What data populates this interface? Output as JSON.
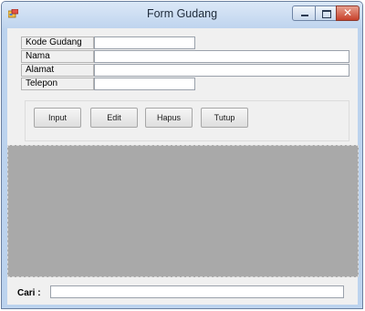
{
  "window": {
    "title": "Form Gudang"
  },
  "titlebar": {
    "icon": "form-app-icon",
    "buttons": {
      "minimize": "minimize-icon",
      "maximize": "maximize-icon",
      "close": "close-icon",
      "close_glyph": "✕"
    }
  },
  "form": {
    "fields": [
      {
        "label": "Kode Gudang",
        "value": ""
      },
      {
        "label": "Nama",
        "value": ""
      },
      {
        "label": "Alamat",
        "value": ""
      },
      {
        "label": "Telepon",
        "value": ""
      }
    ]
  },
  "actions": {
    "input": "Input",
    "edit": "Edit",
    "hapus": "Hapus",
    "tutup": "Tutup"
  },
  "search": {
    "label": "Cari :",
    "value": ""
  },
  "colors": {
    "grid_background": "#a9a9a9",
    "client_background": "#f0f0f0",
    "title_bar": "#bfd4ee",
    "close_button": "#c7402a"
  }
}
